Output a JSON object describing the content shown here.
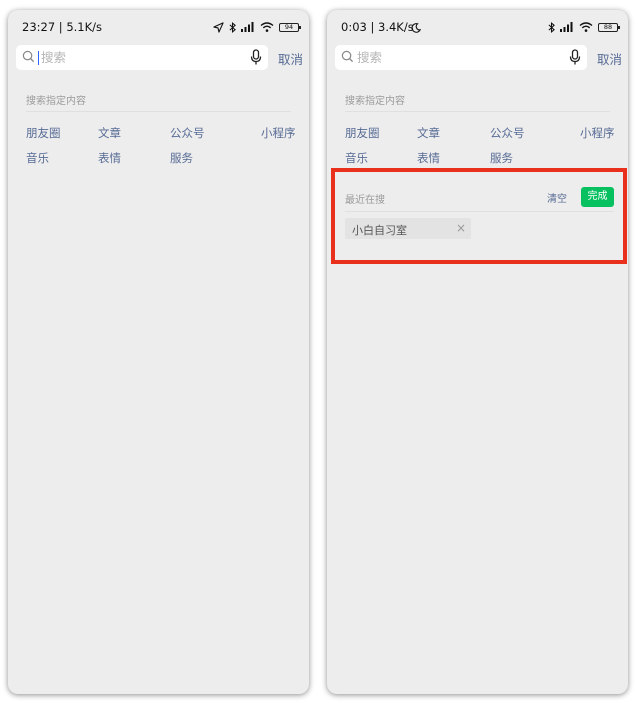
{
  "left_screen": {
    "status": {
      "text": "23:27 | 5.1K/s",
      "battery": "94"
    },
    "search": {
      "placeholder": "搜索",
      "cancel": "取消"
    },
    "section_title": "搜索指定内容",
    "categories": [
      "朋友圈",
      "文章",
      "公众号",
      "小程序",
      "音乐",
      "表情",
      "服务"
    ]
  },
  "right_screen": {
    "status": {
      "text": "0:03 | 3.4K/s",
      "battery": "88"
    },
    "search": {
      "placeholder": "搜索",
      "cancel": "取消"
    },
    "section_title": "搜索指定内容",
    "categories": [
      "朋友圈",
      "文章",
      "公众号",
      "小程序",
      "音乐",
      "表情",
      "服务"
    ],
    "recent": {
      "label": "最近在搜",
      "clear": "清空",
      "done": "完成",
      "items": [
        "小白自习室"
      ]
    }
  },
  "colors": {
    "link": "#576b95",
    "accent_green": "#07c160",
    "highlight_red": "#e8301d",
    "background": "#ededed"
  }
}
